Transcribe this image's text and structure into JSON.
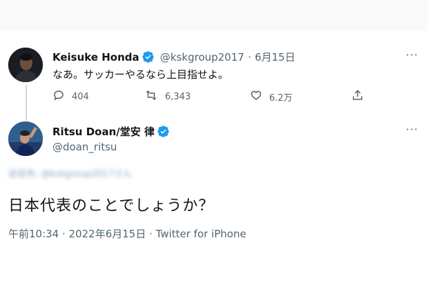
{
  "tweet1": {
    "name": "Keisuke Honda",
    "handle": "@kskgroup2017",
    "sep": "·",
    "date": "6月15日",
    "text": "なあ。サッカーやるなら上目指せよ。",
    "replies": "404",
    "retweets": "6,343",
    "likes": "6.2万",
    "more": "···"
  },
  "tweet2": {
    "name": "Ritsu Doan/堂安 律",
    "handle": "@doan_ritsu",
    "reply_context": "返信先: @kskgroup2017さん",
    "text": "日本代表のことでしょうか？",
    "meta": "午前10:34 · 2022年6月15日 · Twitter for iPhone",
    "more": "···"
  },
  "colors": {
    "verified": "#1d9bf0",
    "muted": "#536471"
  }
}
